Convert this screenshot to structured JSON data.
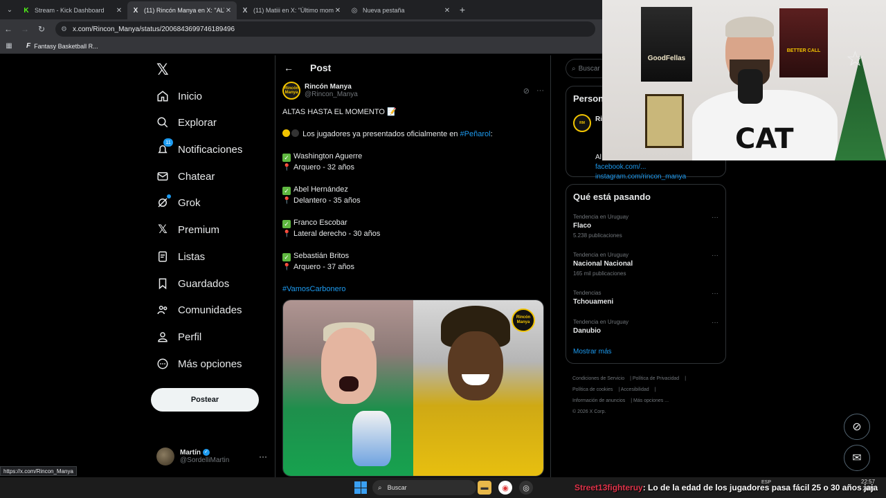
{
  "browser": {
    "tabs": [
      {
        "title": "Stream - Kick Dashboard",
        "favicon": "K",
        "active": false
      },
      {
        "title": "(11) Rincón Manya en X: \"ALTAS",
        "favicon": "X",
        "active": true
      },
      {
        "title": "(11) Matiii en X: \"Último mom",
        "favicon": "X",
        "active": false
      },
      {
        "title": "Nueva pestaña",
        "favicon": "◎",
        "active": false
      }
    ],
    "url": "x.com/Rincon_Manya/status/2006843699746189496",
    "bookmark": "Fantasy Basketball R...",
    "status_link": "https://x.com/Rincon_Manya"
  },
  "nav": {
    "items": [
      {
        "label": "Inicio",
        "icon": "home-icon"
      },
      {
        "label": "Explorar",
        "icon": "search-icon"
      },
      {
        "label": "Notificaciones",
        "icon": "bell-icon",
        "badge": "11"
      },
      {
        "label": "Chatear",
        "icon": "mail-icon"
      },
      {
        "label": "Grok",
        "icon": "grok-icon"
      },
      {
        "label": "Premium",
        "icon": "x-icon"
      },
      {
        "label": "Listas",
        "icon": "list-icon"
      },
      {
        "label": "Guardados",
        "icon": "bookmark-icon"
      },
      {
        "label": "Comunidades",
        "icon": "people-icon"
      },
      {
        "label": "Perfil",
        "icon": "user-icon"
      },
      {
        "label": "Más opciones",
        "icon": "more-circle-icon"
      }
    ],
    "post_button": "Postear",
    "user": {
      "name": "Martín",
      "handle": "@SordelliMartin"
    }
  },
  "post": {
    "header": "Post",
    "author": {
      "name": "Rincón Manya",
      "handle": "@Rincon_Manya",
      "avatar_text": "Rincón Manya"
    },
    "title_line": "ALTAS HASTA EL MOMENTO 📝",
    "intro": "Los jugadores ya presentados oficialmente en ",
    "intro_tag": "#Peñarol",
    "intro_end": ":",
    "players": [
      {
        "name": "Washington Aguerre",
        "detail": "Arquero - 32 años"
      },
      {
        "name": "Abel Hernández",
        "detail": "Delantero - 35 años"
      },
      {
        "name": "Franco Escobar",
        "detail": "Lateral derecho - 30 años"
      },
      {
        "name": "Sebastián Britos",
        "detail": "Arquero - 37 años"
      }
    ],
    "hashtag": "#VamosCarbonero",
    "media_badge": "Rincón Manya"
  },
  "sidebar": {
    "search_placeholder": "Buscar",
    "who_title": "Person",
    "who_name": "Rin",
    "who_links": [
      "Al",
      "facebook.com/...",
      "instagram.com/rincon_manya"
    ],
    "trends_title": "Qué está pasando",
    "trends": [
      {
        "category": "Tendencia en Uruguay",
        "name": "Flaco",
        "count": "5.238 publicaciones"
      },
      {
        "category": "Tendencia en Uruguay",
        "name": "Nacional Nacional",
        "count": "165 mil publicaciones"
      },
      {
        "category": "Tendencias",
        "name": "Tchouameni",
        "count": ""
      },
      {
        "category": "Tendencia en Uruguay",
        "name": "Danubio",
        "count": ""
      }
    ],
    "show_more": "Mostrar más",
    "footer": [
      "Condiciones de Servicio",
      "Política de Privacidad",
      "Política de cookies",
      "Accesibilidad",
      "Información de anuncios",
      "Más opciones ...",
      "© 2026 X Corp."
    ]
  },
  "webcam": {
    "poster1": "GoodFellas",
    "poster2": "BETTER CALL",
    "shirt_logo": "CAT"
  },
  "taskbar": {
    "search": "Buscar",
    "chat_user": "Street13fighteruy",
    "chat_message": ": Lo de la edad de los jugadores pasa fácil 25 o 30 años jaja",
    "lang": "ESP",
    "time": "22:57",
    "date": "2026"
  }
}
